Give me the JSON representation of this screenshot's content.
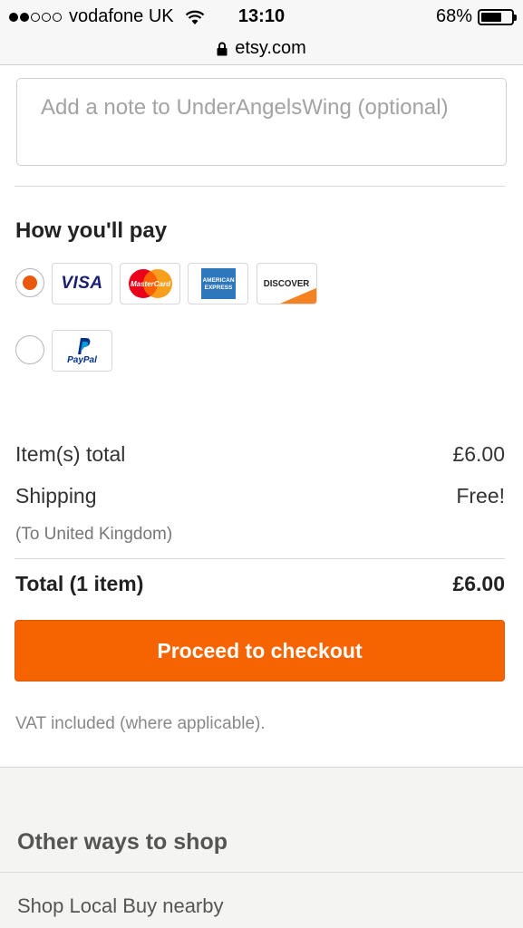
{
  "status_bar": {
    "carrier": "vodafone UK",
    "time": "13:10",
    "battery": "68%",
    "battery_level": 0.68
  },
  "url_bar": {
    "domain": "etsy.com"
  },
  "note": {
    "placeholder": "Add a note to UnderAngelsWing (optional)"
  },
  "payment": {
    "title": "How you'll pay",
    "cards": {
      "visa": "VISA",
      "mastercard": "MasterCard",
      "amex_line1": "AMERICAN",
      "amex_line2": "EXPRESS",
      "discover": "DISCOVER"
    },
    "paypal": "PayPal"
  },
  "summary": {
    "items_label": "Item(s) total",
    "items_value": "£6.00",
    "shipping_label": "Shipping",
    "shipping_value": "Free!",
    "shipping_dest": "(To United Kingdom)",
    "total_label": "Total (1 item)",
    "total_value": "£6.00"
  },
  "checkout": {
    "label": "Proceed to checkout"
  },
  "vat": "VAT included (where applicable).",
  "other": {
    "title": "Other ways to shop",
    "link": "Shop Local Buy nearby"
  },
  "colors": {
    "accent": "#f56400",
    "radio_selected": "#e8590c",
    "visa_blue": "#1a1f71",
    "amex_blue": "#2e77bc",
    "discover_orange": "#f58220",
    "paypal_dark": "#003087",
    "paypal_light": "#009cde"
  }
}
